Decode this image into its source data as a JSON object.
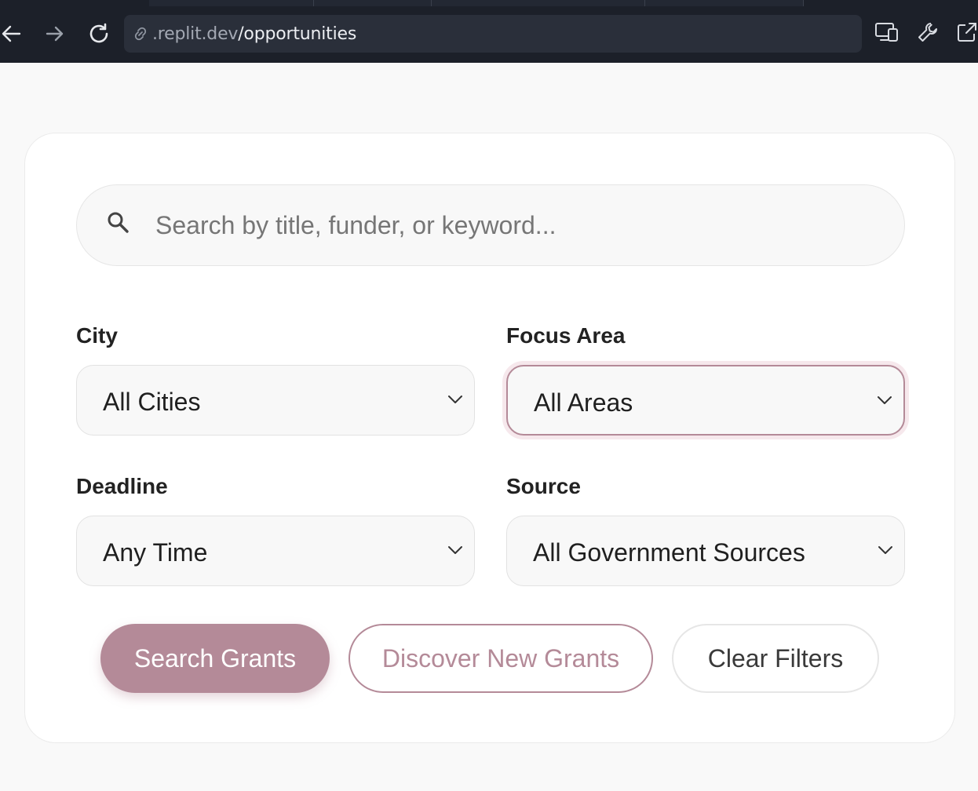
{
  "browser": {
    "url_host": ".replit.dev",
    "url_path": "/opportunities",
    "icons": [
      "back-arrow-icon",
      "forward-arrow-icon",
      "reload-icon",
      "link-icon",
      "devices-icon",
      "wrench-icon",
      "open-external-icon"
    ]
  },
  "search": {
    "placeholder": "Search by title, funder, or keyword...",
    "value": ""
  },
  "filters": {
    "city": {
      "label": "City",
      "selected": "All Cities"
    },
    "focus_area": {
      "label": "Focus Area",
      "selected": "All Areas"
    },
    "deadline": {
      "label": "Deadline",
      "selected": "Any Time"
    },
    "source": {
      "label": "Source",
      "selected": "All Government Sources"
    }
  },
  "actions": {
    "search_label": "Search Grants",
    "discover_label": "Discover New Grants",
    "clear_label": "Clear Filters"
  },
  "colors": {
    "accent": "#b48a98",
    "chrome_bg": "#1c2029",
    "page_bg": "#f9f9f9"
  }
}
